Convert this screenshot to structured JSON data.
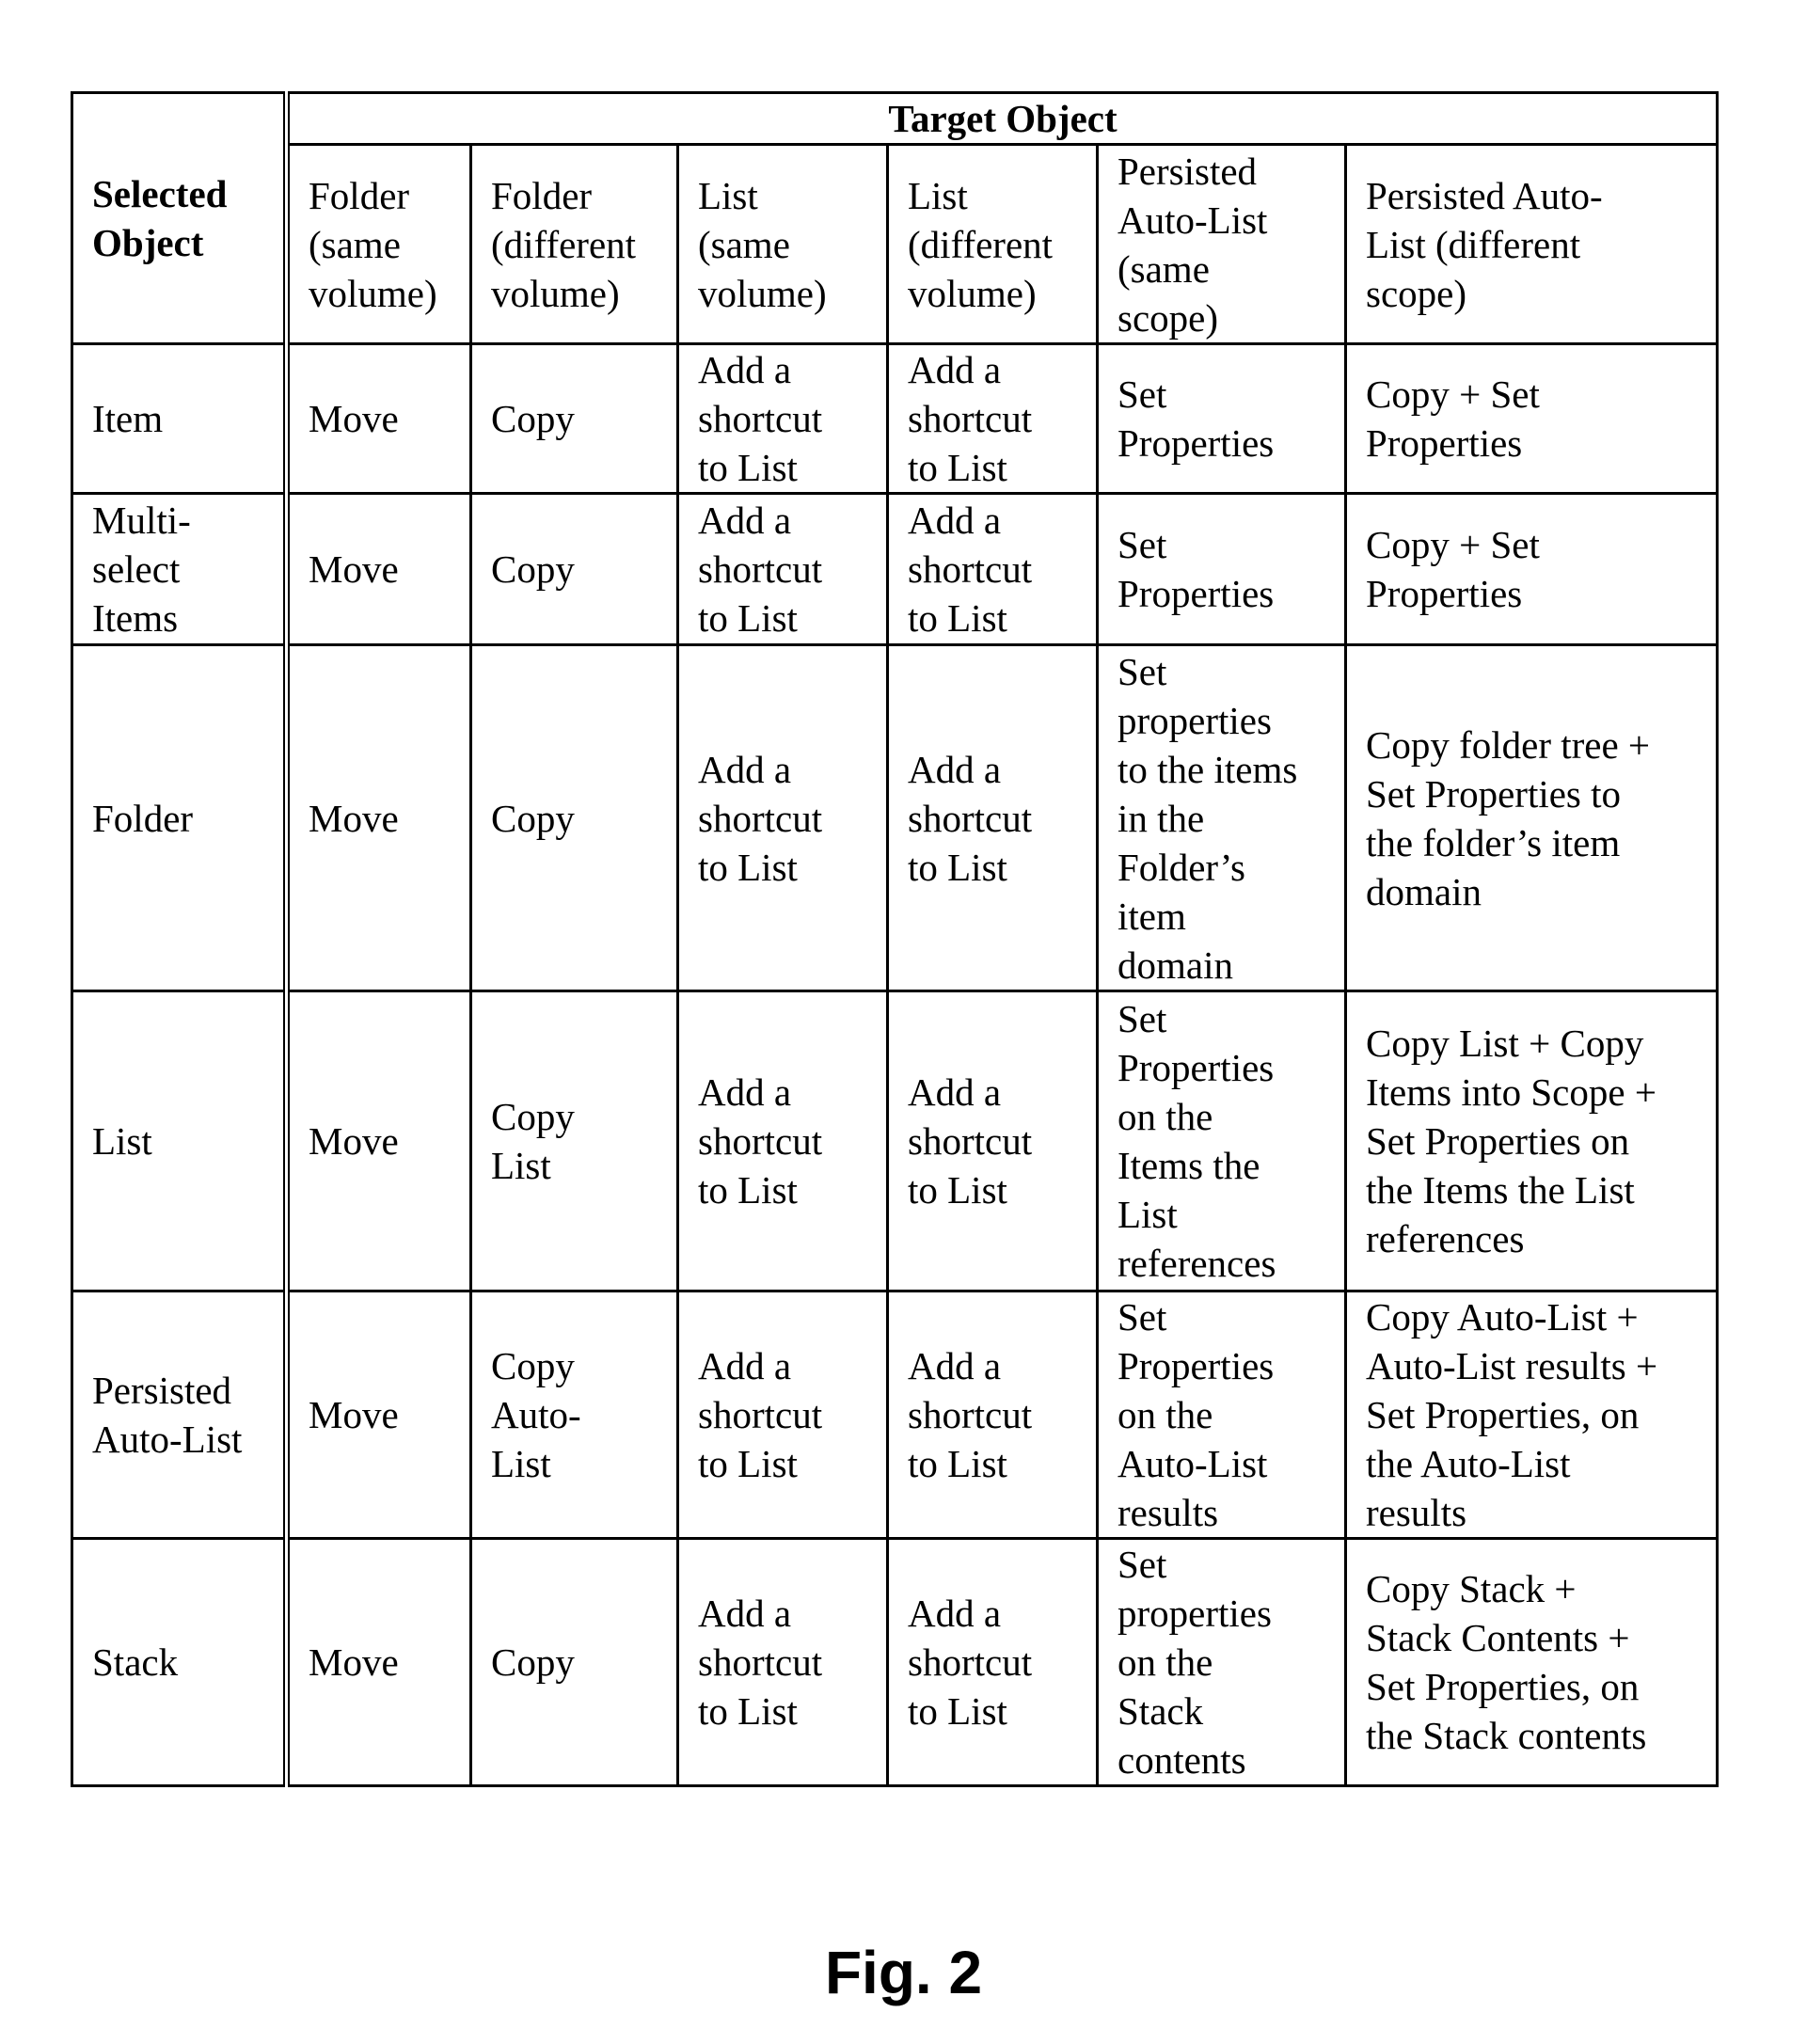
{
  "table": {
    "selected_header": "Selected Object",
    "target_header": "Target Object",
    "columns": [
      "Folder (same volume)",
      "Folder (different volume)",
      "List (same volume)",
      "List (different volume)",
      "Persisted Auto-List (same scope)",
      "Persisted Auto-List (different scope)"
    ],
    "column_lines": [
      "Folder\n(same\nvolume)",
      "Folder\n(different\nvolume)",
      "List\n(same\nvolume)",
      "List\n(different\nvolume)",
      "Persisted\nAuto-List\n(same\nscope)",
      "Persisted Auto-\nList (different\nscope)"
    ],
    "selected_header_lines": "Selected\nObject",
    "rows": [
      {
        "selected": "Item",
        "cells": [
          "Move",
          "Copy",
          "Add a\nshortcut\nto List",
          "Add a\nshortcut\nto List",
          "Set\nProperties",
          "Copy + Set\nProperties"
        ]
      },
      {
        "selected": "Multi-\nselect\nItems",
        "cells": [
          "Move",
          "Copy",
          "Add a\nshortcut\nto List",
          "Add a\nshortcut\nto List",
          "Set\nProperties",
          "Copy + Set\nProperties"
        ]
      },
      {
        "selected": "Folder",
        "cells": [
          "Move",
          "Copy",
          "Add a\nshortcut\nto List",
          "Add a\nshortcut\nto List",
          "Set\nproperties\nto the items\nin the\nFolder’s\nitem\ndomain",
          "Copy folder tree +\nSet Properties to\nthe folder’s item\ndomain"
        ]
      },
      {
        "selected": "List",
        "cells": [
          "Move",
          "Copy\nList",
          "Add a\nshortcut\nto List",
          "Add a\nshortcut\nto List",
          "Set\nProperties\non the\nItems the\nList\nreferences",
          "Copy List + Copy\nItems into Scope +\nSet Properties on\nthe Items the List\nreferences"
        ]
      },
      {
        "selected": "Persisted\nAuto-List",
        "cells": [
          "Move",
          "Copy\nAuto-\nList",
          "Add a\nshortcut\nto List",
          "Add a\nshortcut\nto List",
          "Set\nProperties\non the\nAuto-List\nresults",
          "Copy Auto-List +\nAuto-List results +\nSet Properties, on\nthe Auto-List\nresults"
        ]
      },
      {
        "selected": "Stack",
        "cells": [
          "Move",
          "Copy",
          "Add a\nshortcut\nto List",
          "Add a\nshortcut\nto List",
          "Set\nproperties\non the\nStack\ncontents",
          "Copy Stack +\nStack Contents +\nSet Properties, on\nthe Stack contents"
        ]
      }
    ]
  },
  "caption": "Fig. 2"
}
